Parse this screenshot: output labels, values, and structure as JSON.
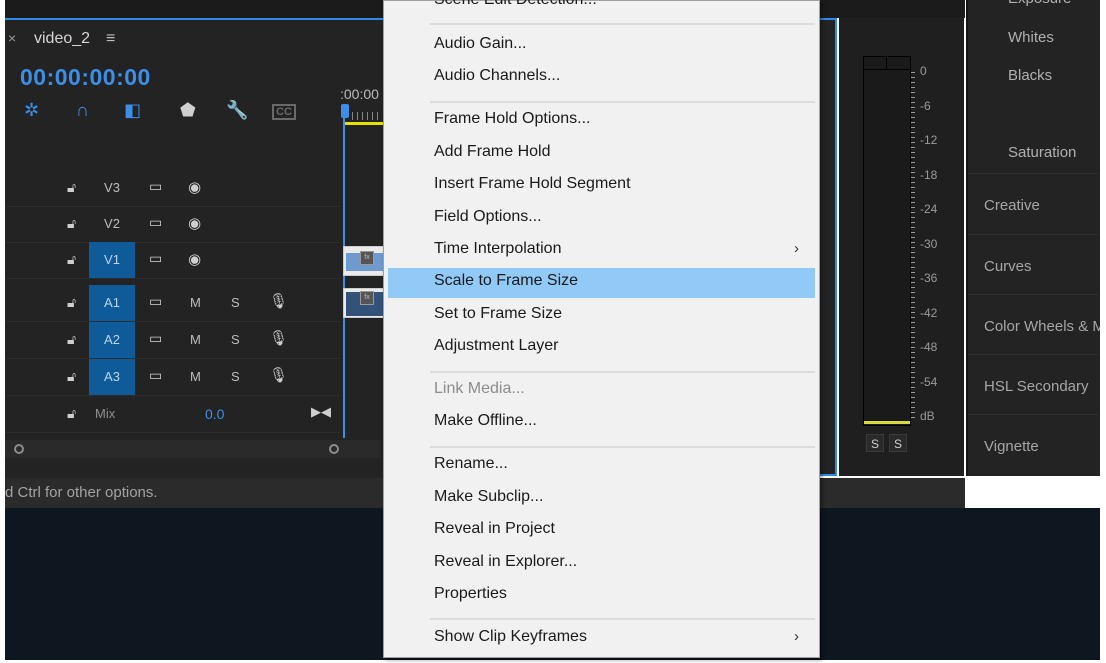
{
  "timeline": {
    "close_icon": "×",
    "sequence_name": "video_2",
    "menu_icon": "≡",
    "timecode": "00:00:00:00",
    "ruler_label": ":00:00",
    "tools": [
      {
        "name": "nest-snap-icon",
        "glyph": "✲",
        "color": "#3d8ee6"
      },
      {
        "name": "snap-magnet-icon",
        "glyph": "∩",
        "color": "#3d8ee6"
      },
      {
        "name": "linked-selection-icon",
        "glyph": "◧",
        "color": "#3d8ee6"
      },
      {
        "name": "add-marker-icon",
        "glyph": "⬟",
        "color": "#cfcfcf"
      },
      {
        "name": "timeline-settings-wrench-icon",
        "glyph": "🔧",
        "color": "#cfcfcf"
      },
      {
        "name": "captions-icon",
        "glyph": "CC",
        "color": "#6a6a6a"
      }
    ],
    "video_tracks": [
      {
        "label": "V3",
        "active": false
      },
      {
        "label": "V2",
        "active": false
      },
      {
        "label": "V1",
        "active": true
      }
    ],
    "audio_tracks": [
      {
        "label": "A1",
        "active": true,
        "mute": "M",
        "solo": "S"
      },
      {
        "label": "A2",
        "active": true,
        "mute": "M",
        "solo": "S"
      },
      {
        "label": "A3",
        "active": true,
        "mute": "M",
        "solo": "S"
      }
    ],
    "mix": {
      "label": "Mix",
      "value": "0.0"
    },
    "clip_fx_badge": "fx"
  },
  "status_bar": {
    "text": "d Ctrl for other options."
  },
  "audio_meter": {
    "labels": [
      "0",
      "-6",
      "-12",
      "-18",
      "-24",
      "-30",
      "-36",
      "-42",
      "-48",
      "-54",
      "dB"
    ],
    "solo_buttons": [
      "S",
      "S"
    ],
    "level_color": "#d8dc3a"
  },
  "lumetri": {
    "partial_top": "Exposure",
    "sub_items": [
      "Whites",
      "Blacks",
      "Saturation"
    ],
    "sections": [
      "Creative",
      "Curves",
      "Color Wheels & Match",
      "HSL Secondary",
      "Vignette"
    ]
  },
  "context_menu": {
    "partial_top": "Scene Edit Detection...",
    "groups": [
      [
        {
          "label": "Audio Gain..."
        },
        {
          "label": "Audio Channels..."
        }
      ],
      [
        {
          "label": "Frame Hold Options..."
        },
        {
          "label": "Add Frame Hold"
        },
        {
          "label": "Insert Frame Hold Segment"
        },
        {
          "label": "Field Options..."
        },
        {
          "label": "Time Interpolation",
          "submenu": true
        },
        {
          "label": "Scale to Frame Size",
          "highlighted": true
        },
        {
          "label": "Set to Frame Size"
        },
        {
          "label": "Adjustment Layer"
        }
      ],
      [
        {
          "label": "Link Media...",
          "disabled": true
        },
        {
          "label": "Make Offline..."
        }
      ],
      [
        {
          "label": "Rename..."
        },
        {
          "label": "Make Subclip..."
        },
        {
          "label": "Reveal in Project"
        },
        {
          "label": "Reveal in Explorer..."
        },
        {
          "label": "Properties"
        }
      ],
      [
        {
          "label": "Show Clip Keyframes",
          "submenu": true
        }
      ]
    ],
    "submenu_arrow": "›",
    "highlight_color": "#91c9f7"
  },
  "colors": {
    "accent": "#2d8ceb",
    "timecode": "#3d8ee6",
    "track_active": "#0f5a98",
    "panel_bg": "#232323"
  }
}
